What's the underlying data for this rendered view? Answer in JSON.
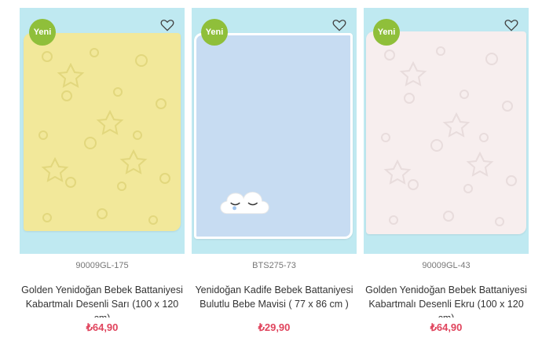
{
  "products": [
    {
      "badge": "Yeni",
      "sku": "90009GL-175",
      "name": "Golden Yenidoğan Bebek Battaniyesi Kabartmalı Desenli Sarı (100 x 120 cm)",
      "price": "₺64,90",
      "blanket_color": "#f2e89a",
      "pattern_color": "#e2d77d",
      "icon": "heart-outline-icon"
    },
    {
      "badge": "Yeni",
      "sku": "BTS275-73",
      "name": "Yenidoğan Kadife Bebek Battaniyesi Bulutlu Bebe Mavisi ( 77 x 86 cm )",
      "price": "₺29,90",
      "blanket_color": "#c7dcf2",
      "pattern_color": "#ffffff",
      "icon": "heart-outline-icon"
    },
    {
      "badge": "Yeni",
      "sku": "90009GL-43",
      "name": "Golden Yenidoğan Bebek Battaniyesi Kabartmalı Desenli Ekru (100 x 120 cm)",
      "price": "₺64,90",
      "blanket_color": "#f7eeee",
      "pattern_color": "#e8dcdc",
      "icon": "heart-outline-icon"
    }
  ],
  "colors": {
    "image_bg": "#bfe9f1",
    "badge_bg": "#8fbf3a",
    "price": "#e0445d"
  }
}
